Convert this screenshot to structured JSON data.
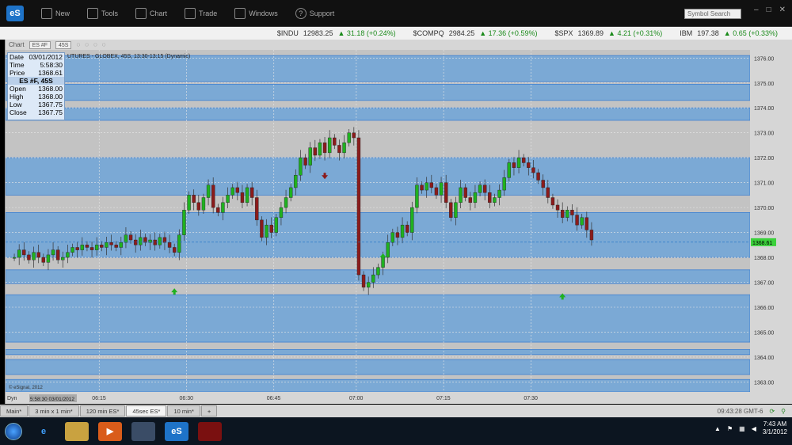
{
  "app": {
    "logo": "eS"
  },
  "toolbar": {
    "new": "New",
    "tools": "Tools",
    "chart": "Chart",
    "trade": "Trade",
    "windows": "Windows",
    "support": "Support",
    "symbol_search": "Symbol Search"
  },
  "ticker": [
    {
      "sym": "$INDU",
      "price": "12983.25",
      "chg": "31.18 (+0.24%)"
    },
    {
      "sym": "$COMPQ",
      "price": "2984.25",
      "chg": "17.36 (+0.59%)"
    },
    {
      "sym": "$SPX",
      "price": "1369.89",
      "chg": "4.21 (+0.31%)"
    },
    {
      "sym": "IBM",
      "price": "197.38",
      "chg": "0.65 (+0.33%)"
    }
  ],
  "chart_tools": {
    "type": "Chart",
    "symbol": "ES #F",
    "interval": "45S"
  },
  "chart_header": "UTURES - GLOBEX, 45S, 13:30-13:15 (Dynamic)",
  "data_window": {
    "date_label": "Date",
    "date": "03/01/2012",
    "time_label": "Time",
    "time": "5:58:30",
    "price_label": "Price",
    "price": "1368.61",
    "symbol": "ES #F, 45S",
    "open_label": "Open",
    "open": "1368.00",
    "high_label": "High",
    "high": "1368.00",
    "low_label": "Low",
    "low": "1367.75",
    "close_label": "Close",
    "close": "1367.75"
  },
  "chart_data": {
    "type": "candlestick",
    "y_ticks": [
      "1376.00",
      "1375.00",
      "1374.00",
      "1373.00",
      "1372.00",
      "1371.00",
      "1370.00",
      "1369.00",
      "1368.00",
      "1367.00",
      "1366.00",
      "1365.00",
      "1364.00",
      "1363.00"
    ],
    "ylim": [
      1362.6,
      1376.2
    ],
    "x_ticks": [
      "06:15",
      "06:30",
      "06:45",
      "07:00",
      "07:15",
      "07:30"
    ],
    "last_price": "1368.61",
    "x_start_label": "5:58:30 03/01/2012",
    "copyright": "© eSignal, 2012",
    "dyn_label": "Dyn",
    "bands": [
      [
        1376.1,
        1375.05
      ],
      [
        1374.95,
        1374.3
      ],
      [
        1374.0,
        1373.5
      ],
      [
        1372.0,
        1370.5
      ],
      [
        1369.8,
        1368.0
      ],
      [
        1367.5,
        1366.95
      ],
      [
        1366.5,
        1364.6
      ],
      [
        1364.3,
        1364.1
      ],
      [
        1363.9,
        1363.3
      ],
      [
        1363.1,
        1362.6
      ]
    ],
    "up_arrows": [
      [
        33,
        1366.6
      ],
      [
        76,
        1368.0
      ],
      [
        113,
        1366.4
      ]
    ],
    "down_arrows": [
      [
        64,
        1371.3
      ]
    ],
    "prices": [
      1368.0,
      1368.3,
      1368.1,
      1367.9,
      1368.2,
      1368.0,
      1367.8,
      1368.1,
      1368.3,
      1367.9,
      1368.0,
      1368.2,
      1368.4,
      1368.3,
      1368.5,
      1368.4,
      1368.3,
      1368.5,
      1368.4,
      1368.6,
      1368.5,
      1368.4,
      1368.6,
      1368.9,
      1368.7,
      1368.5,
      1368.8,
      1368.6,
      1368.7,
      1368.5,
      1368.8,
      1368.6,
      1368.4,
      1368.2,
      1368.9,
      1369.9,
      1370.5,
      1370.2,
      1369.9,
      1370.4,
      1370.9,
      1370.0,
      1369.8,
      1370.2,
      1370.5,
      1370.8,
      1370.6,
      1370.2,
      1370.8,
      1370.4,
      1369.5,
      1368.8,
      1369.3,
      1369.0,
      1369.6,
      1370.0,
      1370.4,
      1370.8,
      1371.3,
      1372.0,
      1371.7,
      1372.4,
      1372.1,
      1372.6,
      1372.2,
      1372.8,
      1372.5,
      1372.2,
      1372.6,
      1373.0,
      1372.8,
      1367.3,
      1366.8,
      1367.0,
      1367.3,
      1367.6,
      1368.0,
      1368.6,
      1369.0,
      1368.8,
      1369.3,
      1369.0,
      1370.0,
      1370.9,
      1370.7,
      1371.0,
      1370.8,
      1370.5,
      1371.0,
      1370.2,
      1369.6,
      1370.2,
      1370.8,
      1370.4,
      1370.2,
      1370.6,
      1370.9,
      1370.6,
      1370.2,
      1370.4,
      1370.7,
      1371.2,
      1371.8,
      1371.6,
      1372.0,
      1371.8,
      1371.6,
      1371.4,
      1371.1,
      1370.8,
      1370.4,
      1370.1,
      1369.9,
      1369.6,
      1369.9,
      1369.7,
      1369.3,
      1369.6,
      1369.1,
      1368.7
    ]
  },
  "tabs": [
    "Main*",
    "3 min x 1 min*",
    "120 min ES*",
    "45sec ES*",
    "10 min*"
  ],
  "active_tab": "45sec ES*",
  "status": {
    "time": "09:43:28 GMT-6"
  },
  "taskbar": {
    "time": "7:43 AM",
    "date": "3/1/2012"
  },
  "colors": {
    "up": "#1fb11f",
    "down": "#8b1b1b",
    "band": "#7ba9d5",
    "band_line": "#3d7fd1",
    "accent": "#1e73c8"
  }
}
